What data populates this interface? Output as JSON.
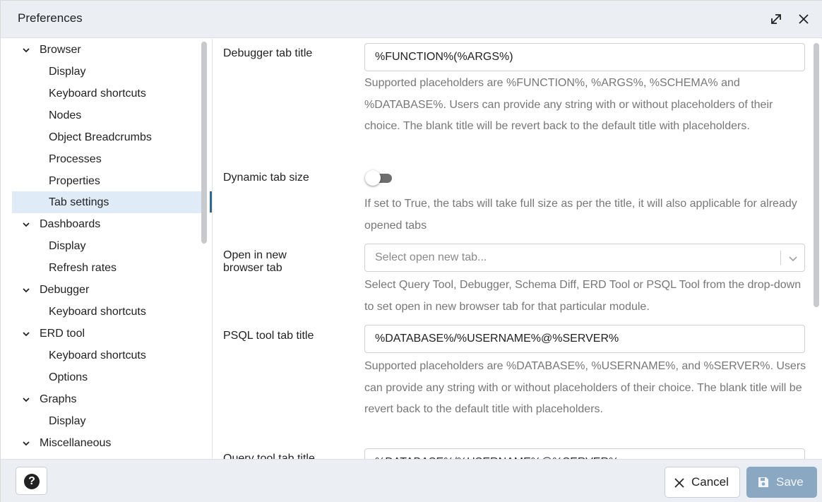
{
  "window": {
    "title": "Preferences"
  },
  "tree": {
    "items": [
      {
        "label": "Browser",
        "type": "group"
      },
      {
        "label": "Display",
        "type": "leaf"
      },
      {
        "label": "Keyboard shortcuts",
        "type": "leaf"
      },
      {
        "label": "Nodes",
        "type": "leaf"
      },
      {
        "label": "Object Breadcrumbs",
        "type": "leaf"
      },
      {
        "label": "Processes",
        "type": "leaf"
      },
      {
        "label": "Properties",
        "type": "leaf"
      },
      {
        "label": "Tab settings",
        "type": "leaf",
        "selected": true
      },
      {
        "label": "Dashboards",
        "type": "group"
      },
      {
        "label": "Display",
        "type": "leaf"
      },
      {
        "label": "Refresh rates",
        "type": "leaf"
      },
      {
        "label": "Debugger",
        "type": "group"
      },
      {
        "label": "Keyboard shortcuts",
        "type": "leaf"
      },
      {
        "label": "ERD tool",
        "type": "group"
      },
      {
        "label": "Keyboard shortcuts",
        "type": "leaf"
      },
      {
        "label": "Options",
        "type": "leaf"
      },
      {
        "label": "Graphs",
        "type": "group"
      },
      {
        "label": "Display",
        "type": "leaf"
      },
      {
        "label": "Miscellaneous",
        "type": "group"
      }
    ]
  },
  "form": {
    "debugger_tab_title": {
      "label": "Debugger tab title",
      "value": "%FUNCTION%(%ARGS%)",
      "help": "Supported placeholders are %FUNCTION%, %ARGS%, %SCHEMA% and %DATABASE%. Users can provide any string with or without placeholders of their choice. The blank title will be revert back to the default title with placeholders."
    },
    "dynamic_tab_size": {
      "label": "Dynamic tab size",
      "enabled": false,
      "help": "If set to True, the tabs will take full size as per the title, it will also applicable for already opened tabs"
    },
    "open_in_new_tab": {
      "label": "Open in new browser tab",
      "placeholder": "Select open new tab...",
      "help": "Select Query Tool, Debugger, Schema Diff, ERD Tool or PSQL Tool from the drop-down to set open in new browser tab for that particular module."
    },
    "psql_tab_title": {
      "label": "PSQL tool tab title",
      "value": "%DATABASE%/%USERNAME%@%SERVER%",
      "help": "Supported placeholders are %DATABASE%, %USERNAME%, and %SERVER%. Users can provide any string with or without placeholders of their choice. The blank title will be revert back to the default title with placeholders."
    },
    "query_tool_tab_title": {
      "label": "Query tool tab title",
      "value": "%DATABASE%/%USERNAME%@%SERVER%"
    }
  },
  "footer": {
    "help_label": "?",
    "cancel_label": "Cancel",
    "save_label": "Save"
  },
  "colors": {
    "titlebar_bg": "#ebeef3",
    "selected_bg": "#dfecf8",
    "accent": "#326690",
    "save_bg": "#8ba8c3"
  },
  "icons": {
    "expand": "expand-icon",
    "close": "close-icon",
    "chevron": "chevron-down-icon",
    "help": "help-icon",
    "cancel": "close-icon",
    "save": "save-icon"
  }
}
